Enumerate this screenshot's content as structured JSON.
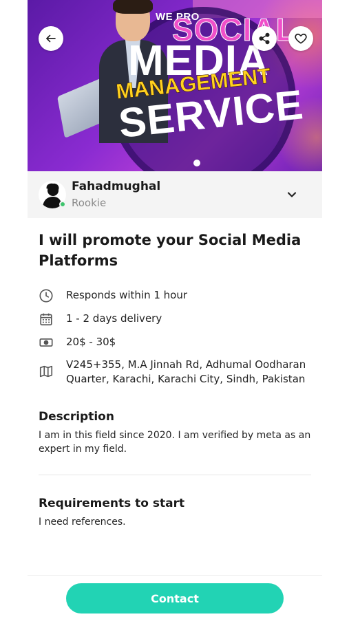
{
  "banner": {
    "line1": "WE PRO",
    "line2": "SOCIAL",
    "line3": "MEDIA",
    "line4": "MANAGEMENT",
    "line5": "SERVICE"
  },
  "seller": {
    "name": "Fahadmughal",
    "level": "Rookie",
    "online_color": "#3ec46d"
  },
  "gig": {
    "title": "I will promote your Social Media Platforms",
    "response_time": "Responds within 1 hour",
    "delivery": "1 - 2 days delivery",
    "price_range": "20$ - 30$",
    "location_line1": "V245+355, M.A Jinnah Rd, Adhumal Oodharan",
    "location_line2": "Quarter, Karachi, Karachi City, Sindh, Pakistan"
  },
  "description": {
    "heading": "Description",
    "body": "I am in this field since 2020. I am verified by meta as an expert in my field."
  },
  "requirements": {
    "heading": "Requirements to start",
    "body": "I need references."
  },
  "actions": {
    "contact_label": "Contact",
    "contact_color": "#22d3b4"
  },
  "icons": {
    "back": "arrow-left-icon",
    "share": "share-icon",
    "favorite": "heart-icon",
    "expand": "chevron-down-icon",
    "clock": "clock-icon",
    "calendar": "calendar-icon",
    "money": "money-icon",
    "map": "map-icon"
  }
}
